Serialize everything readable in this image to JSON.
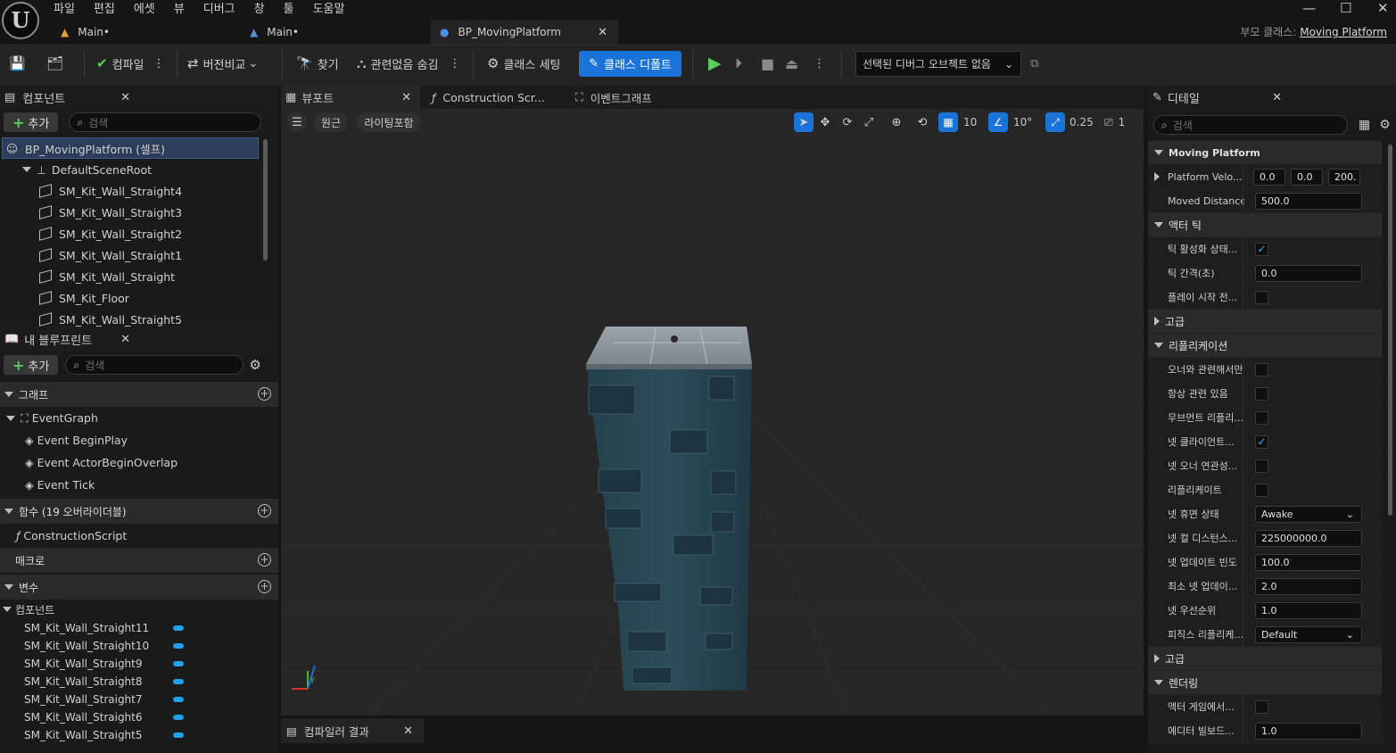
{
  "menu": [
    "파일",
    "편집",
    "에셋",
    "뷰",
    "디버그",
    "창",
    "툴",
    "도움말"
  ],
  "window_controls": {
    "minimize": "—",
    "maximize": "☐",
    "close": "✕"
  },
  "doc_tabs": [
    {
      "label": "Main•",
      "active": false
    },
    {
      "label": "Main•",
      "active": false
    },
    {
      "label": "BP_MovingPlatform",
      "active": true,
      "close": "✕"
    }
  ],
  "parent_class": {
    "label": "부모 클래스:",
    "value": "Moving Platform"
  },
  "toolbar": {
    "compile": "컴파일",
    "diff": "버전비교",
    "find": "찾기",
    "hide_unrelated": "관련없음 숨김",
    "class_settings": "클래스 세팅",
    "class_defaults": "클래스 디폴트",
    "debug_object": "선택된 디버그 오브젝트 없음"
  },
  "components_panel": {
    "title": "컴포넌트",
    "add": "추가",
    "search_placeholder": "검색",
    "root": "BP_MovingPlatform (셀프)",
    "scene_root": "DefaultSceneRoot",
    "items": [
      "SM_Kit_Wall_Straight4",
      "SM_Kit_Wall_Straight3",
      "SM_Kit_Wall_Straight2",
      "SM_Kit_Wall_Straight1",
      "SM_Kit_Wall_Straight",
      "SM_Kit_Floor",
      "SM_Kit_Wall_Straight5"
    ]
  },
  "my_blueprint": {
    "title": "내 블루프린트",
    "add": "추가",
    "search_placeholder": "검색",
    "graphs_label": "그래프",
    "event_graph": "EventGraph",
    "events": [
      "Event BeginPlay",
      "Event ActorBeginOverlap",
      "Event Tick"
    ],
    "functions_label": "함수 (19 오버라이더블)",
    "construction_script": "ConstructionScript",
    "macros_label": "매크로",
    "variables_label": "변수",
    "components_label": "컴포넌트",
    "variables": [
      "SM_Kit_Wall_Straight11",
      "SM_Kit_Wall_Straight10",
      "SM_Kit_Wall_Straight9",
      "SM_Kit_Wall_Straight8",
      "SM_Kit_Wall_Straight7",
      "SM_Kit_Wall_Straight6",
      "SM_Kit_Wall_Straight5"
    ]
  },
  "editor_tabs": {
    "viewport": "뷰포트",
    "construction": "Construction Scr...",
    "event_graph": "이벤트그래프"
  },
  "viewport_toolbar": {
    "perspective": "원근",
    "lighting": "라이팅포함",
    "grid": "10",
    "rotation": "10°",
    "scale": "0.25",
    "camera": "1"
  },
  "bottom_tab": {
    "label": "컴파일러 결과"
  },
  "details": {
    "title": "디테일",
    "search_placeholder": "검색",
    "sections": [
      {
        "name": "Moving Platform",
        "bold": true,
        "rows": [
          {
            "label": "Platform Velo...",
            "vec": [
              "0.0",
              "0.0",
              "200."
            ],
            "reset": true
          },
          {
            "label": "Moved Distance",
            "value": "500.0",
            "reset": true
          }
        ]
      },
      {
        "name": "액터 틱",
        "rows": [
          {
            "label": "틱 활성화 상태...",
            "check": true
          },
          {
            "label": "틱 간격(초)",
            "value": "0.0"
          },
          {
            "label": "플레이 시작 전...",
            "check": false
          }
        ]
      },
      {
        "name": "고급",
        "collapsed": true,
        "rows": []
      },
      {
        "name": "리플리케이션",
        "rows": [
          {
            "label": "오너와 관련해서만",
            "check": false
          },
          {
            "label": "항상 관련 있음",
            "check": false
          },
          {
            "label": "무브먼트 리플리...",
            "check": false
          },
          {
            "label": "넷 클라이언트...",
            "check": true
          },
          {
            "label": "넷 오너 연관성...",
            "check": false
          },
          {
            "label": "리플리케이트",
            "check": false
          },
          {
            "label": "넷 휴면 상태",
            "select": "Awake"
          },
          {
            "label": "넷 컬 디스턴스...",
            "value": "225000000.0"
          },
          {
            "label": "넷 업데이트 빈도",
            "value": "100.0"
          },
          {
            "label": "최소 넷 업데이...",
            "value": "2.0"
          },
          {
            "label": "넷 우선순위",
            "value": "1.0"
          },
          {
            "label": "피직스 리플리케...",
            "select": "Default"
          }
        ]
      },
      {
        "name": "고급",
        "collapsed": true,
        "rows": []
      },
      {
        "name": "렌더링",
        "rows": [
          {
            "label": "액터 게임에서...",
            "check": false
          },
          {
            "label": "에디터 빌보드...",
            "value": "1.0"
          }
        ]
      }
    ]
  },
  "colors": {
    "accent": "#1a73d9",
    "selection": "#2b3d5a",
    "var_pill": "#1ea0e6",
    "play": "#5bd05b"
  }
}
